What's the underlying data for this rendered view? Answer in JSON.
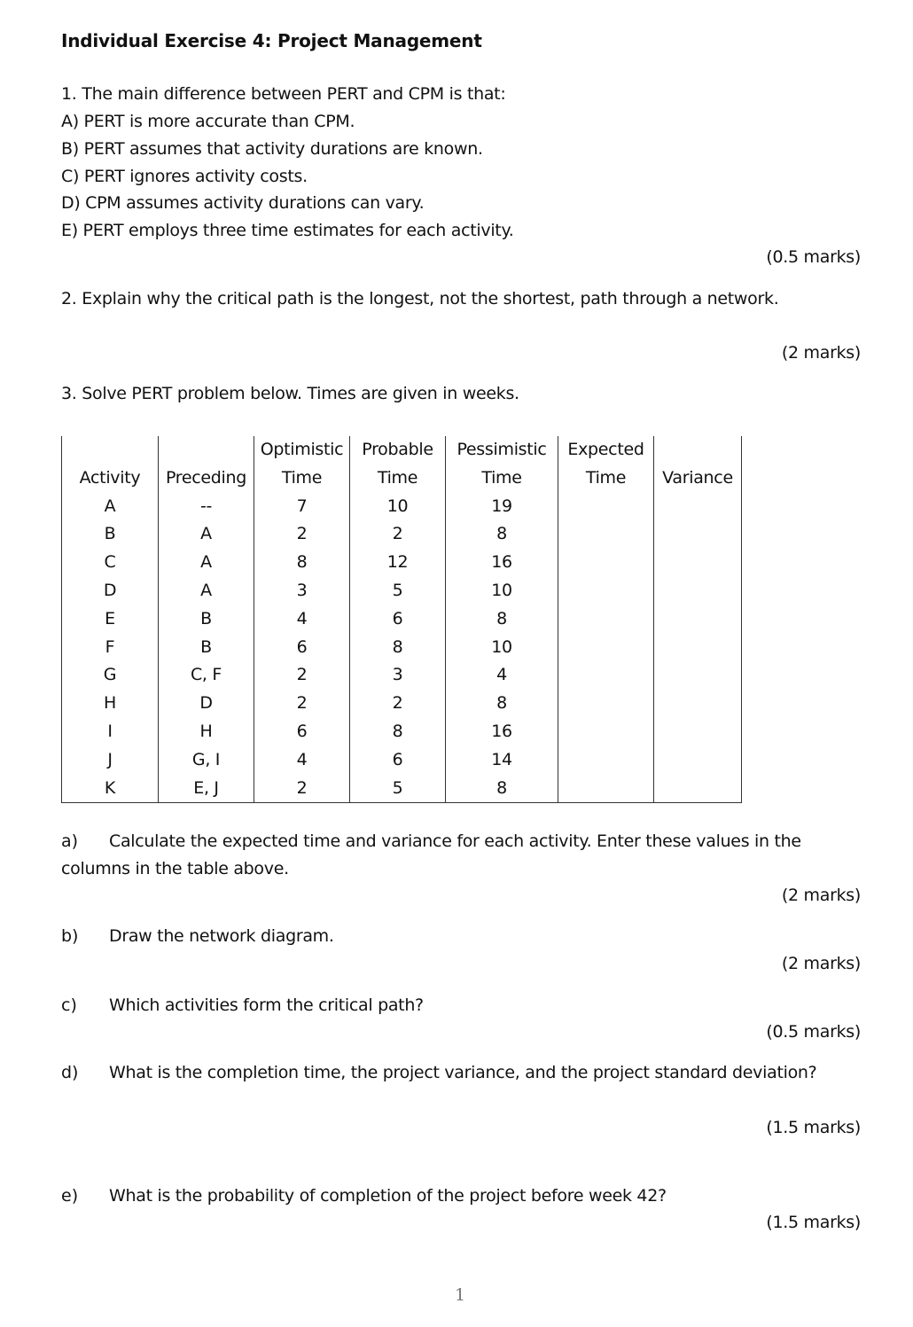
{
  "title": "Individual Exercise 4: Project Management",
  "q1": {
    "question": "1. The main difference between PERT and CPM is that:",
    "options": [
      "A) PERT is more accurate than CPM.",
      "B) PERT assumes that activity durations are known.",
      "C) PERT ignores activity costs.",
      "D) CPM assumes activity durations can vary.",
      "E) PERT employs three time estimates for each activity."
    ],
    "marks": "(0.5 marks)"
  },
  "q2": {
    "question": "2. Explain why the critical path is the longest, not the shortest, path through a network.",
    "marks": "(2 marks)"
  },
  "q3": {
    "question": "3. Solve PERT problem below. Times are given in weeks.",
    "table": {
      "headers": [
        {
          "line1": "",
          "line2": "Activity"
        },
        {
          "line1": "",
          "line2": "Preceding"
        },
        {
          "line1": "Optimistic",
          "line2": "Time"
        },
        {
          "line1": "Probable",
          "line2": "Time"
        },
        {
          "line1": "Pessimistic",
          "line2": "Time"
        },
        {
          "line1": "Expected",
          "line2": "Time"
        },
        {
          "line1": "",
          "line2": "Variance"
        }
      ],
      "rows": [
        [
          "A",
          "--",
          "7",
          "10",
          "19",
          "",
          ""
        ],
        [
          "B",
          "A",
          "2",
          "2",
          "8",
          "",
          ""
        ],
        [
          "C",
          "A",
          "8",
          "12",
          "16",
          "",
          ""
        ],
        [
          "D",
          "A",
          "3",
          "5",
          "10",
          "",
          ""
        ],
        [
          "E",
          "B",
          "4",
          "6",
          "8",
          "",
          ""
        ],
        [
          "F",
          "B",
          "6",
          "8",
          "10",
          "",
          ""
        ],
        [
          "G",
          "C, F",
          "2",
          "3",
          "4",
          "",
          ""
        ],
        [
          "H",
          "D",
          "2",
          "2",
          "8",
          "",
          ""
        ],
        [
          "I",
          "H",
          "6",
          "8",
          "16",
          "",
          ""
        ],
        [
          "J",
          "G, I",
          "4",
          "6",
          "14",
          "",
          ""
        ],
        [
          "K",
          "E, J",
          "2",
          "5",
          "8",
          "",
          ""
        ]
      ]
    },
    "parts": [
      {
        "label": "a)",
        "text": "Calculate the expected time and variance for each activity. Enter these values in the",
        "text2": "columns in the table above.",
        "marks": "(2 marks)"
      },
      {
        "label": "b)",
        "text": "Draw the network diagram.",
        "marks": "(2 marks)"
      },
      {
        "label": "c)",
        "text": "Which activities form the critical path?",
        "marks": "(0.5 marks)"
      },
      {
        "label": "d)",
        "text": "What is the completion time, the project variance, and the project standard deviation?",
        "marks": "(1.5 marks)"
      },
      {
        "label": "e)",
        "text": "What is the probability of completion of the project before week 42?",
        "marks": "(1.5 marks)"
      }
    ]
  },
  "page_number": "1"
}
